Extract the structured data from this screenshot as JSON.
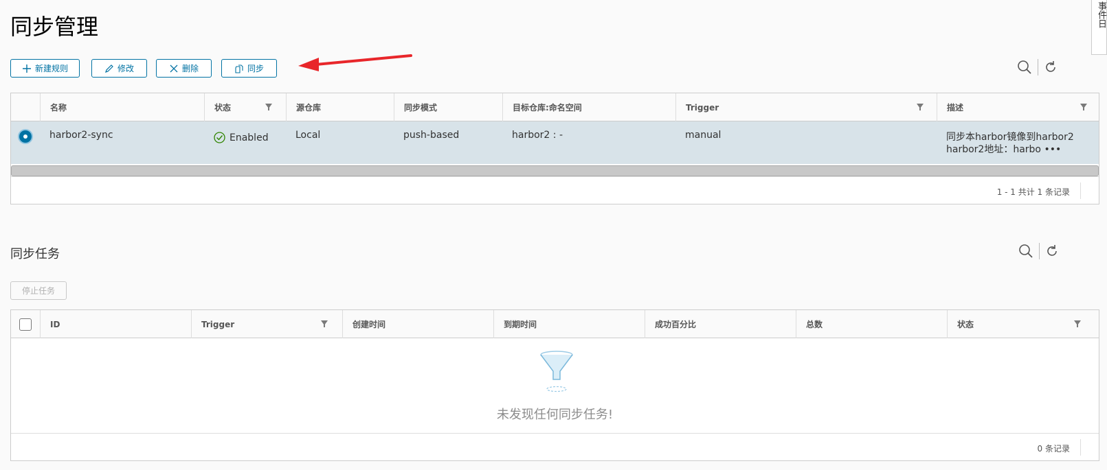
{
  "page": {
    "title": "同步管理"
  },
  "toolbar": {
    "new_label": "新建规则",
    "edit_label": "修改",
    "delete_label": "删除",
    "sync_label": "同步"
  },
  "rules_table": {
    "columns": [
      "名称",
      "状态",
      "源仓库",
      "同步模式",
      "目标仓库:命名空间",
      "Trigger",
      "描述"
    ],
    "rows": [
      {
        "name": "harbor2-sync",
        "status": "Enabled",
        "source": "Local",
        "mode": "push-based",
        "target": "harbor2 : -",
        "trigger": "manual",
        "desc_line1": "同步本harbor镜像到harbor2",
        "desc_line2": "harbor2地址：harbo",
        "desc_more": "•••"
      }
    ],
    "footer": "1 - 1 共计 1 条记录"
  },
  "tasks": {
    "title": "同步任务",
    "stop_label": "停止任务",
    "columns": [
      "ID",
      "Trigger",
      "创建时间",
      "到期时间",
      "成功百分比",
      "总数",
      "状态"
    ],
    "empty_text": "未发现任何同步任务!",
    "footer": "0 条记录"
  },
  "side_tab": {
    "label": "事件日"
  },
  "colors": {
    "accent": "#0072a3",
    "selected_row": "#d8e3e9",
    "arrow": "#e8262a",
    "enabled": "#2f8400"
  }
}
